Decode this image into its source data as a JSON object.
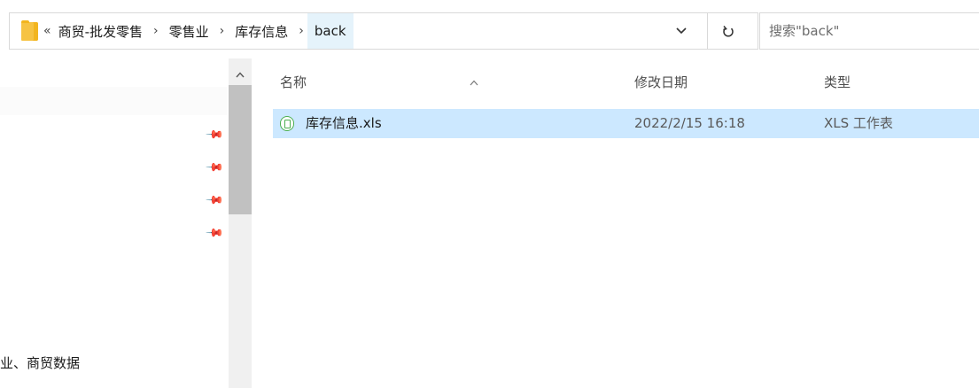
{
  "address_bar": {
    "overflow": "«",
    "crumbs": [
      "商贸-批发零售",
      "零售业",
      "库存信息"
    ],
    "current": "back",
    "dropdown_icon": "chevron-down-icon",
    "refresh_icon": "refresh-icon"
  },
  "search": {
    "placeholder": "搜索\"back\""
  },
  "nav": {
    "pin_icon": "pin-icon",
    "partial_item": "业、商贸数据"
  },
  "columns": {
    "name": "名称",
    "modified": "修改日期",
    "type": "类型"
  },
  "files": [
    {
      "name": "库存信息.xls",
      "modified": "2022/2/15 16:18",
      "type": "XLS 工作表",
      "selected": true
    }
  ],
  "colors": {
    "selection": "#cce8ff",
    "folder": "#f6c343",
    "xls_icon": "#4caf50"
  }
}
